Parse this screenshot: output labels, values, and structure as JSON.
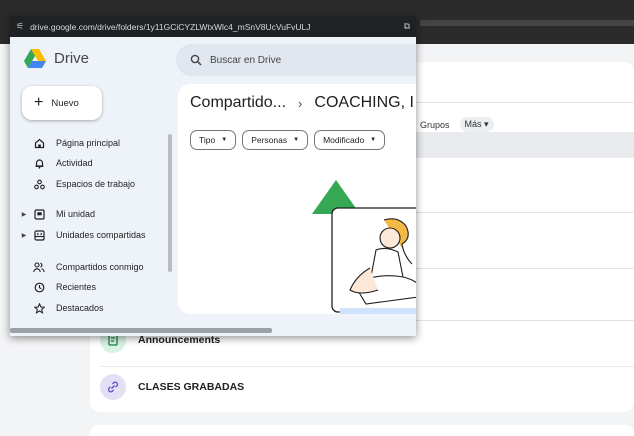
{
  "browser": {
    "url": "drive.google.com/drive/folders/1y11GCiCYZLWtxWlc4_mSnV8UcVuFvULJ"
  },
  "app": {
    "name": "Drive",
    "search_placeholder": "Buscar en Drive",
    "new_button": "Nuevo"
  },
  "sidebar": {
    "items": [
      {
        "label": "Página principal",
        "icon": "home-icon"
      },
      {
        "label": "Actividad",
        "icon": "bell-icon"
      },
      {
        "label": "Espacios de trabajo",
        "icon": "workspaces-icon"
      },
      {
        "label": "Mi unidad",
        "icon": "my-drive-icon"
      },
      {
        "label": "Unidades compartidas",
        "icon": "shared-drives-icon"
      },
      {
        "label": "Compartidos conmigo",
        "icon": "shared-people-icon"
      },
      {
        "label": "Recientes",
        "icon": "clock-icon"
      },
      {
        "label": "Destacados",
        "icon": "star-icon"
      }
    ]
  },
  "content": {
    "breadcrumb": [
      "Compartido...",
      "COACHING, I"
    ],
    "filters": [
      "Tipo",
      "Personas",
      "Modificado"
    ]
  },
  "background": {
    "tabs": [
      "Grupos",
      "Más"
    ],
    "rows": [
      {
        "label": "Announcements",
        "icon": "announcement-icon",
        "color": "#d7f3e3"
      },
      {
        "label": "CLASES GRABADAS",
        "icon": "link-icon",
        "color": "#e3e0f5"
      }
    ]
  },
  "colors": {
    "drive_green": "#34a853",
    "drive_yellow": "#fbbc04",
    "drive_blue": "#4285f4"
  }
}
